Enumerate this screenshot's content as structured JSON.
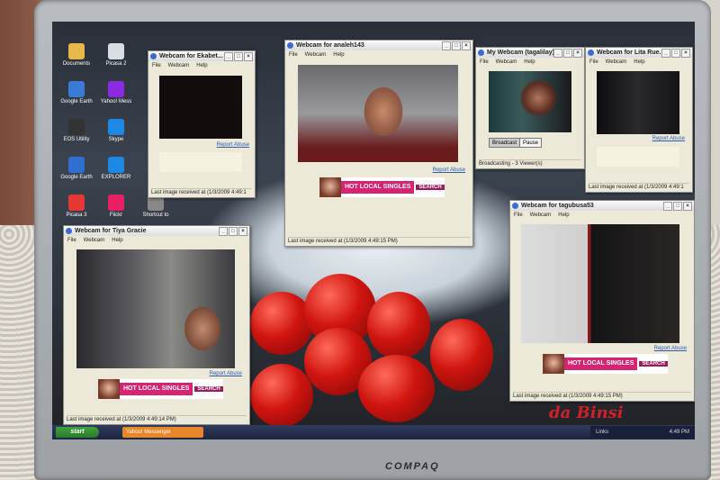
{
  "desktop": {
    "icons": [
      {
        "label": "Documents",
        "color": "#e8b84a"
      },
      {
        "label": "Picasa 2",
        "color": "#d8dde4"
      },
      {
        "label": "Google Earth",
        "color": "#3a7bd5"
      },
      {
        "label": "Yahoo! Mess",
        "color": "#8a2be2"
      },
      {
        "label": "EOS Utility",
        "color": "#333333"
      },
      {
        "label": "Skype",
        "color": "#1e88e5"
      },
      {
        "label": "Google Earth",
        "color": "#2f6fd0"
      },
      {
        "label": "EXPLORER",
        "color": "#1e88e5"
      },
      {
        "label": "Picasa 3",
        "color": "#e53935"
      },
      {
        "label": "Flickr",
        "color": "#e91e63"
      },
      {
        "label": "Shortcut to",
        "color": "#888888"
      }
    ]
  },
  "windows": {
    "ekabet": {
      "title": "Webcam for Ekabet...",
      "menu": [
        "File",
        "Webcam",
        "Help"
      ],
      "report": "Report Abuse",
      "status": "Last image received at (1/3/2009 4:49:1"
    },
    "analeh": {
      "title": "Webcam for analeh143",
      "menu": [
        "File",
        "Webcam",
        "Help"
      ],
      "report": "Report Abuse",
      "ad_text": "HOT LOCAL SINGLES",
      "ad_sub": "SEARCH",
      "status": "Last image received at (1/3/2009 4:49:15 PM)"
    },
    "mywebcam": {
      "title": "My Webcam (tagalilay)",
      "menu": [
        "File",
        "Webcam",
        "Help"
      ],
      "broadcast_button": "Broadcast",
      "pause_button": "Pause",
      "status": "Broadcasting - 3 Viewer(s)"
    },
    "litarue": {
      "title": "Webcam for Lita Rue...",
      "menu": [
        "File",
        "Webcam",
        "Help"
      ],
      "report": "Report Abuse",
      "status": "Last image received at (1/3/2009 4:49:1"
    },
    "tiya": {
      "title": "Webcam for Tiya Gracie",
      "menu": [
        "File",
        "Webcam",
        "Help"
      ],
      "report": "Report Abuse",
      "ad_text": "HOT LOCAL SINGLES",
      "ad_sub": "SEARCH",
      "status": "Last image received at (1/3/2009 4:49:14 PM)"
    },
    "tagubusa": {
      "title": "Webcam for tagubusa53",
      "menu": [
        "File",
        "Webcam",
        "Help"
      ],
      "report": "Report Abuse",
      "ad_text": "HOT LOCAL SINGLES",
      "ad_sub": "SEARCH",
      "status": "Last image received at (1/3/2009 4:49:15 PM)"
    }
  },
  "taskbar": {
    "start_label": "start",
    "task_label": "Yahoo! Messenger",
    "tray_text": "Links",
    "clock": "4:49 PM"
  },
  "signature": "da Binsi",
  "brand": "COMPAQ",
  "colors": {
    "accent": "#d82272",
    "taskbar": "#1d2540",
    "start": "#2a7a2a"
  }
}
